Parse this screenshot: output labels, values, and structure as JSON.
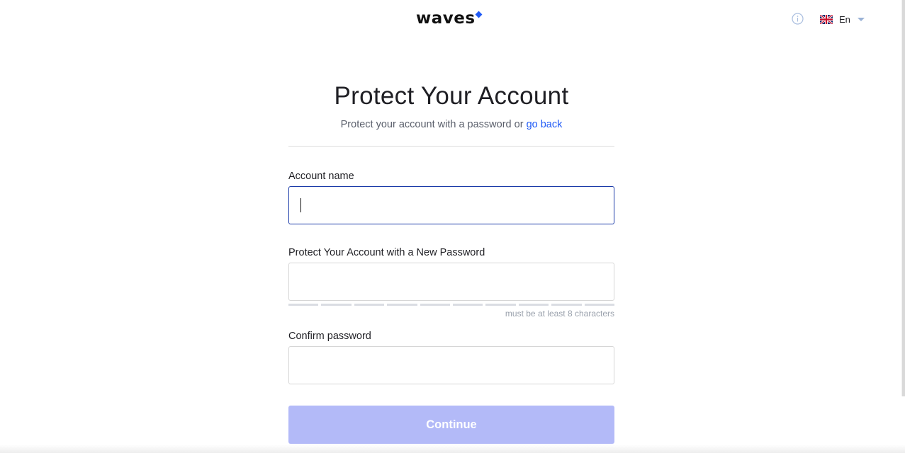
{
  "header": {
    "logo_text": "waves",
    "logo_icon": "diamond-icon",
    "info_icon": "info-icon",
    "language": {
      "label": "En",
      "flag_icon": "uk-flag-icon",
      "chevron_icon": "chevron-down-icon"
    }
  },
  "form": {
    "title": "Protect Your Account",
    "subtitle_prefix": "Protect your account with a password or ",
    "go_back_link": "go back",
    "account_name": {
      "label": "Account name",
      "value": "",
      "placeholder": ""
    },
    "password": {
      "label": "Protect Your Account with a New Password",
      "value": "",
      "placeholder": "",
      "strength_segments": 10,
      "strength_filled": 0,
      "hint": "must be at least 8 characters"
    },
    "confirm_password": {
      "label": "Confirm password",
      "value": "",
      "placeholder": ""
    },
    "continue_label": "Continue"
  },
  "colors": {
    "accent": "#1f5af6",
    "button_disabled": "#b3baf8",
    "focus_border": "#1a3aa8"
  }
}
